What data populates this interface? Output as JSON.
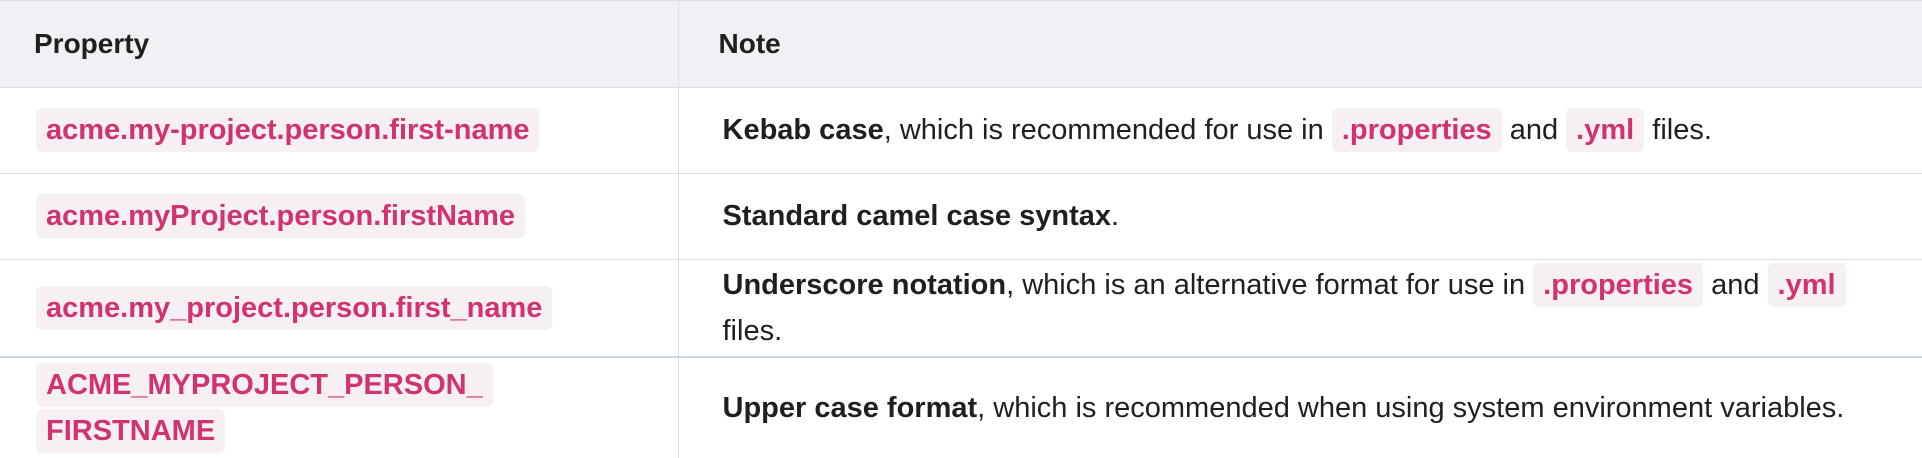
{
  "table": {
    "headers": {
      "property": "Property",
      "note": "Note"
    },
    "rows": [
      {
        "property": "acme.my-project.person.first-name",
        "note": {
          "bold": "Kebab case",
          "text_1": ", which is recommended for use in ",
          "code_1": ".properties",
          "text_2": " and ",
          "code_2": ".yml",
          "text_3": " files."
        }
      },
      {
        "property": "acme.myProject.person.firstName",
        "note": {
          "bold": "Standard camel case syntax",
          "text_1": "."
        }
      },
      {
        "property": "acme.my_project.person.first_name",
        "note": {
          "bold": "Underscore notation",
          "text_1": ", which is an alternative format for use in ",
          "code_1": ".properties",
          "text_2": " and ",
          "code_2": ".yml",
          "text_3": " files."
        }
      },
      {
        "property": "ACME_MYPROJECT_PERSON_FIRSTNAME",
        "note": {
          "bold": "Upper case format",
          "text_1": ", which is recommended when using system environment variables."
        }
      }
    ]
  },
  "colors": {
    "code_text": "#d1336e",
    "code_background": "#f7f0f2",
    "header_background": "#f0f1f5",
    "border": "#d8dde6"
  }
}
